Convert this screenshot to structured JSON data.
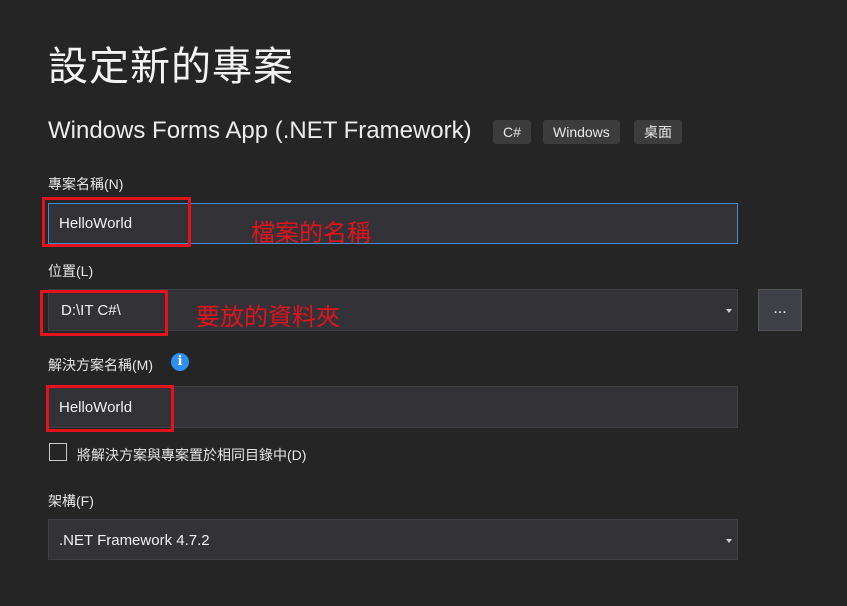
{
  "page": {
    "title": "設定新的專案",
    "template_name": "Windows Forms App (.NET Framework)",
    "tags": [
      "C#",
      "Windows",
      "桌面"
    ]
  },
  "project_name": {
    "label": "專案名稱(N)",
    "value": "HelloWorld",
    "annotation": "檔案的名稱"
  },
  "location": {
    "label": "位置(L)",
    "value": "D:\\IT C#\\",
    "browse_label": "...",
    "annotation": "要放的資料夾"
  },
  "solution_name": {
    "label": "解決方案名稱(M)",
    "value": "HelloWorld",
    "info_icon": "i"
  },
  "same_dir": {
    "label": "將解決方案與專案置於相同目錄中(D)",
    "checked": false
  },
  "framework": {
    "label": "架構(F)",
    "value": ".NET Framework 4.7.2"
  },
  "colors": {
    "background": "#252526",
    "annotation_red": "#e3131e",
    "focus_blue": "#3e8cd6",
    "info_blue": "#2f8ff0"
  }
}
